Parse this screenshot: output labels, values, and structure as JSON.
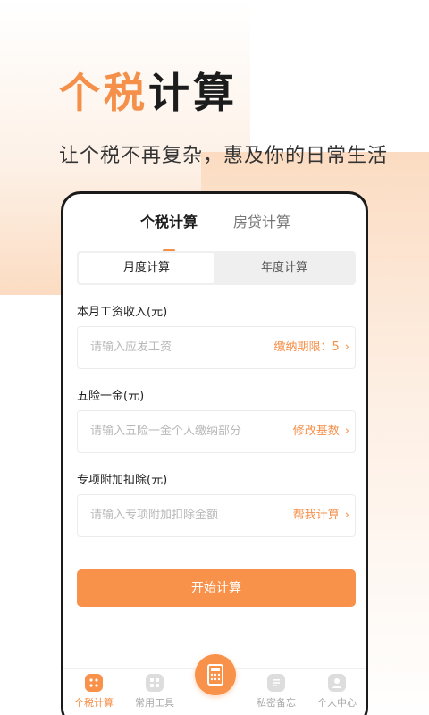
{
  "headline": {
    "accent": "个税",
    "dark": "计算"
  },
  "subtitle": "让个税不再复杂，惠及你的日常生活",
  "top_tabs": {
    "active": "个税计算",
    "inactive": "房贷计算"
  },
  "segment": {
    "monthly": "月度计算",
    "yearly": "年度计算"
  },
  "fields": [
    {
      "label": "本月工资收入(元)",
      "placeholder": "请输入应发工资",
      "action": "缴纳期限：5"
    },
    {
      "label": "五险一金(元)",
      "placeholder": "请输入五险一金个人缴纳部分",
      "action": "修改基数"
    },
    {
      "label": "专项附加扣除(元)",
      "placeholder": "请输入专项附加扣除金额",
      "action": "帮我计算"
    }
  ],
  "chevron": "›",
  "start_button": "开始计算",
  "bottom_nav": {
    "items": [
      {
        "label": "个税计算",
        "icon": "tax-icon"
      },
      {
        "label": "常用工具",
        "icon": "tools-icon"
      },
      {
        "label": "",
        "icon": "calculator-icon"
      },
      {
        "label": "私密备忘",
        "icon": "memo-icon"
      },
      {
        "label": "个人中心",
        "icon": "user-icon"
      }
    ]
  },
  "colors": {
    "accent": "#f5904a",
    "text_dark": "#1c1c1c",
    "inactive": "#aaaaaa"
  }
}
